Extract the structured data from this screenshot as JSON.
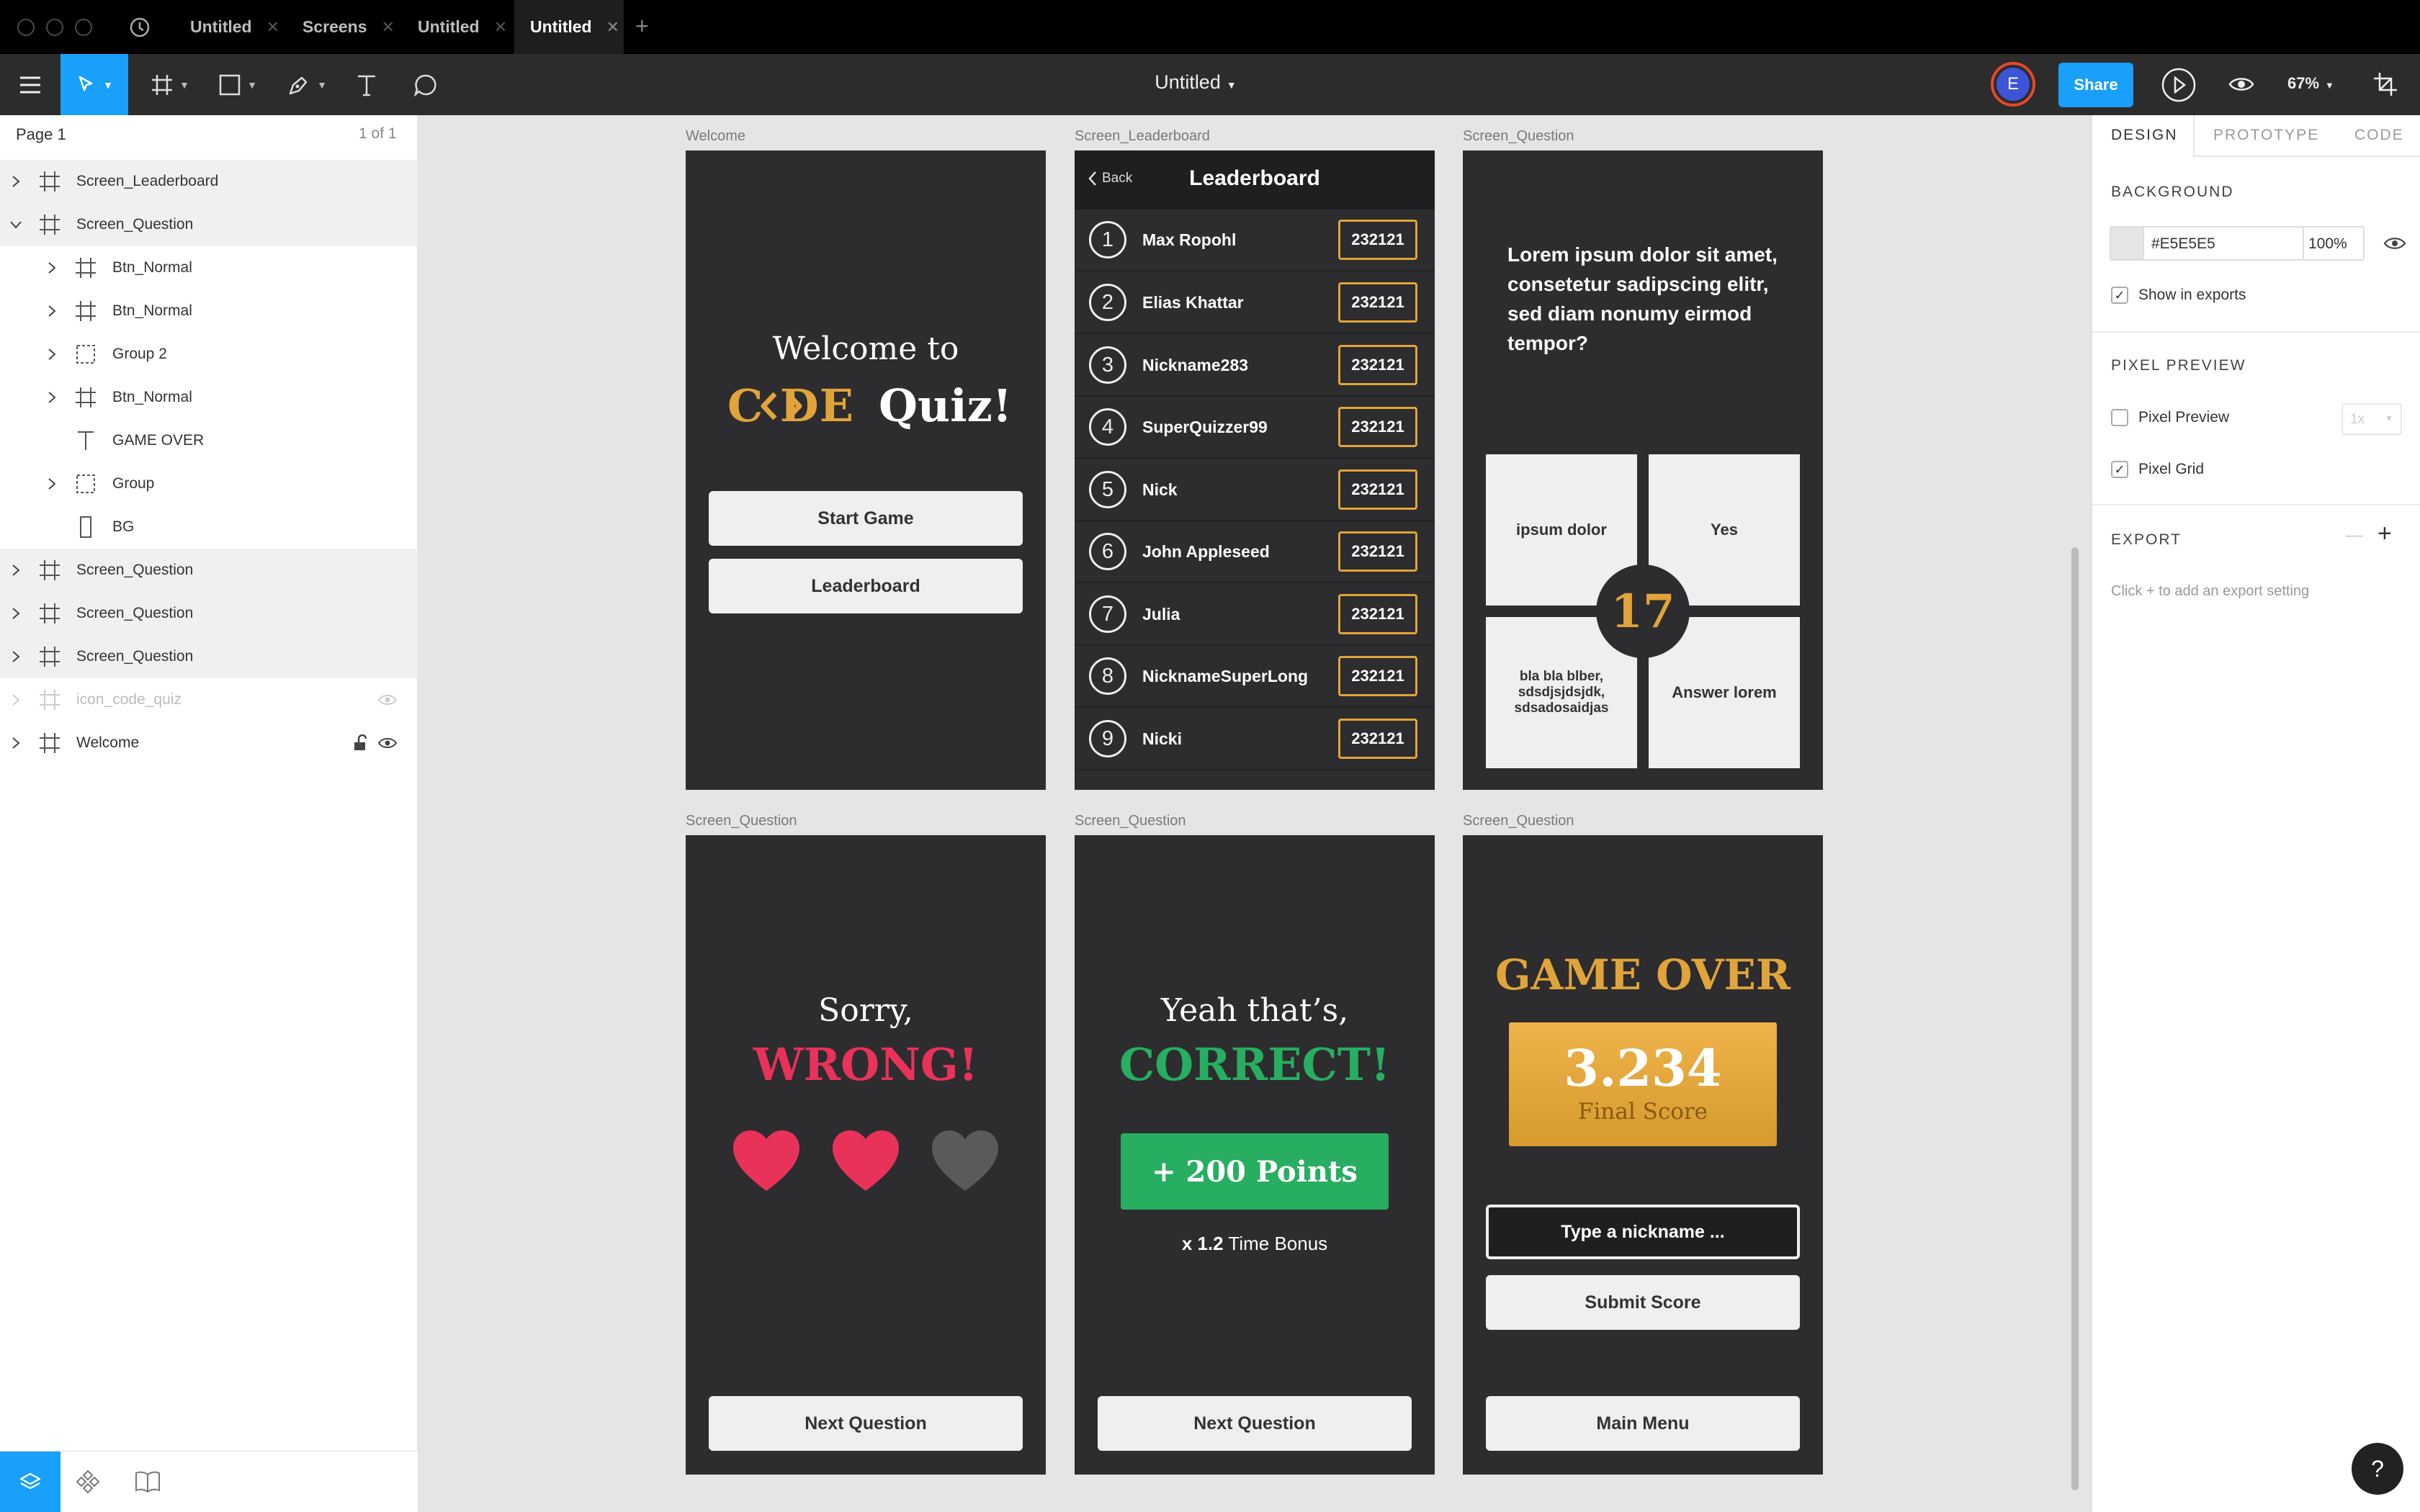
{
  "app": {
    "tabs": [
      {
        "label": "Untitled"
      },
      {
        "label": "Screens"
      },
      {
        "label": "Untitled"
      },
      {
        "label": "Untitled"
      }
    ],
    "file_title": "Untitled",
    "user_initial": "E",
    "share_label": "Share",
    "zoom": "67%"
  },
  "layers": {
    "page_name": "Page 1",
    "page_count": "1 of 1",
    "items": [
      {
        "name": "Screen_Leaderboard"
      },
      {
        "name": "Screen_Question"
      },
      {
        "name": "Btn_Normal"
      },
      {
        "name": "Btn_Normal"
      },
      {
        "name": "Group 2"
      },
      {
        "name": "Btn_Normal"
      },
      {
        "name": "GAME OVER"
      },
      {
        "name": "Group"
      },
      {
        "name": "BG"
      },
      {
        "name": "Screen_Question"
      },
      {
        "name": "Screen_Question"
      },
      {
        "name": "Screen_Question"
      },
      {
        "name": "icon_code_quiz"
      },
      {
        "name": "Welcome"
      }
    ]
  },
  "inspector": {
    "tabs": [
      "DESIGN",
      "PROTOTYPE",
      "CODE"
    ],
    "background_title": "BACKGROUND",
    "bg_color": "#E5E5E5",
    "bg_opacity": "100%",
    "show_in_exports": "Show in exports",
    "pixel_preview_title": "PIXEL PREVIEW",
    "pixel_preview": "Pixel Preview",
    "pixel_scale": "1x",
    "pixel_grid": "Pixel Grid",
    "export_title": "EXPORT",
    "export_hint": "Click + to add an export setting"
  },
  "frames": {
    "welcome": {
      "label": "Welcome",
      "welcome_line": "Welcome to",
      "logo_code": "C  DE",
      "logo_quiz": "Quiz!",
      "start": "Start Game",
      "leaderboard": "Leaderboard"
    },
    "leaderboard": {
      "label": "Screen_Leaderboard",
      "back": "Back",
      "title": "Leaderboard",
      "rows": [
        {
          "rank": "1",
          "name": "Max Ropohl",
          "score": "232121"
        },
        {
          "rank": "2",
          "name": "Elias Khattar",
          "score": "232121"
        },
        {
          "rank": "3",
          "name": "Nickname283",
          "score": "232121"
        },
        {
          "rank": "4",
          "name": "SuperQuizzer99",
          "score": "232121"
        },
        {
          "rank": "5",
          "name": "Nick",
          "score": "232121"
        },
        {
          "rank": "6",
          "name": "John Appleseed",
          "score": "232121"
        },
        {
          "rank": "7",
          "name": "Julia",
          "score": "232121"
        },
        {
          "rank": "8",
          "name": "NicknameSuperLong",
          "score": "232121"
        },
        {
          "rank": "9",
          "name": "Nicki",
          "score": "232121"
        }
      ]
    },
    "question": {
      "label": "Screen_Question",
      "text": "Lorem ipsum dolor sit amet, consetetur sadipscing elitr, sed diam nonumy eirmod tempor?",
      "answers": [
        "ipsum dolor",
        "Yes",
        "bla bla blber, sdsdjsjdsjdk, sdsadosaidjas",
        "Answer lorem"
      ],
      "timer": "17"
    },
    "wrong": {
      "label": "Screen_Question",
      "line1": "Sorry,",
      "line2": "WRONG!",
      "next": "Next Question",
      "lives_remaining": 2,
      "lives_total": 3
    },
    "correct": {
      "label": "Screen_Question",
      "line1": "Yeah that’s,",
      "line2": "CORRECT!",
      "points": "+ 200 Points",
      "bonus_mult": "x 1.2",
      "bonus_text": "Time Bonus",
      "next": "Next Question"
    },
    "gameover": {
      "label": "Screen_Question",
      "title": "GAME OVER",
      "score": "3.234",
      "score_label": "Final Score",
      "nickname_placeholder": "Type a nickname ...",
      "submit": "Submit Score",
      "menu": "Main Menu"
    }
  },
  "colors": {
    "accent_blue": "#18a0fb",
    "frame_bg": "#2d2c2e",
    "gold": "#e0a43a",
    "wrong_red": "#e8325a",
    "correct_green": "#27ae60"
  }
}
